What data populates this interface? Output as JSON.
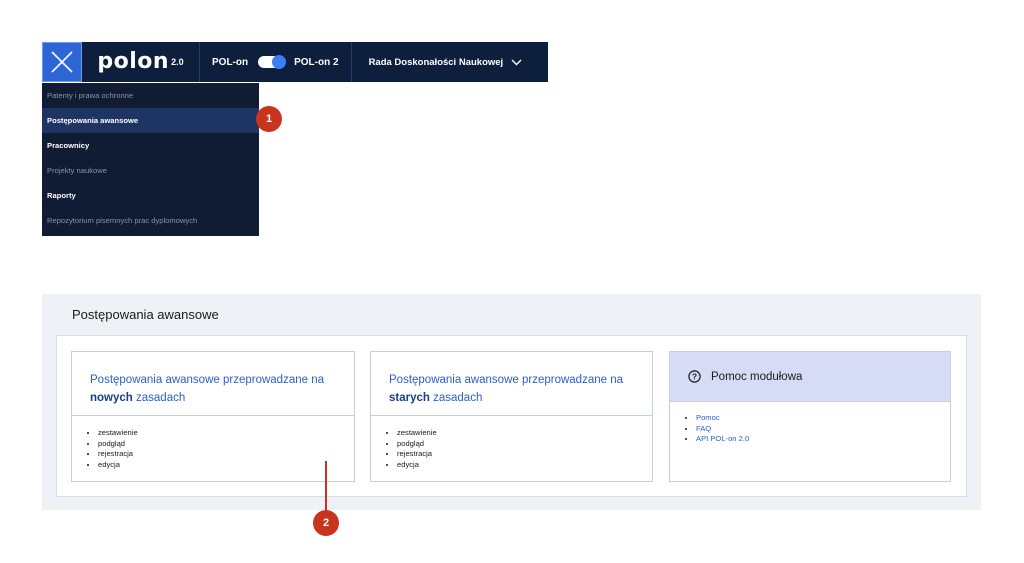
{
  "header": {
    "logo_text": "polon",
    "logo_version": "2.0",
    "toggle_left": "POL-on",
    "toggle_right": "POL-on 2",
    "institution": "Rada Doskonałości Naukowej"
  },
  "menu": {
    "items": [
      {
        "label": "Patenty i prawa ochronne"
      },
      {
        "label": "Postępowania awansowe"
      },
      {
        "label": "Pracownicy"
      },
      {
        "label": "Projekty naukowe"
      },
      {
        "label": "Raporty"
      },
      {
        "label": "Repozytorium pisemnych prac dyplomowych"
      }
    ]
  },
  "markers": {
    "one": "1",
    "two": "2"
  },
  "panel": {
    "title": "Postępowania awansowe",
    "card_new": {
      "title_before": "Postępowania awansowe przeprowadzane na ",
      "title_bold": "nowych",
      "title_after": " zasadach",
      "items": [
        "zestawienie",
        "podgląd",
        "rejestracja",
        "edycja"
      ]
    },
    "card_old": {
      "title_before": "Postępowania awansowe przeprowadzane na ",
      "title_bold": "starych",
      "title_after": " zasadach",
      "items": [
        "zestawienie",
        "podgląd",
        "rejestracja",
        "edycja"
      ]
    },
    "help": {
      "title": "Pomoc modułowa",
      "links": [
        "Pomoc",
        "FAQ",
        "API POL-on 2.0"
      ]
    }
  },
  "colors": {
    "topbar": "#0e1f3d",
    "accent_blue": "#2f66d6",
    "marker_red": "#c9341f",
    "link_blue": "#2a5fc9"
  }
}
